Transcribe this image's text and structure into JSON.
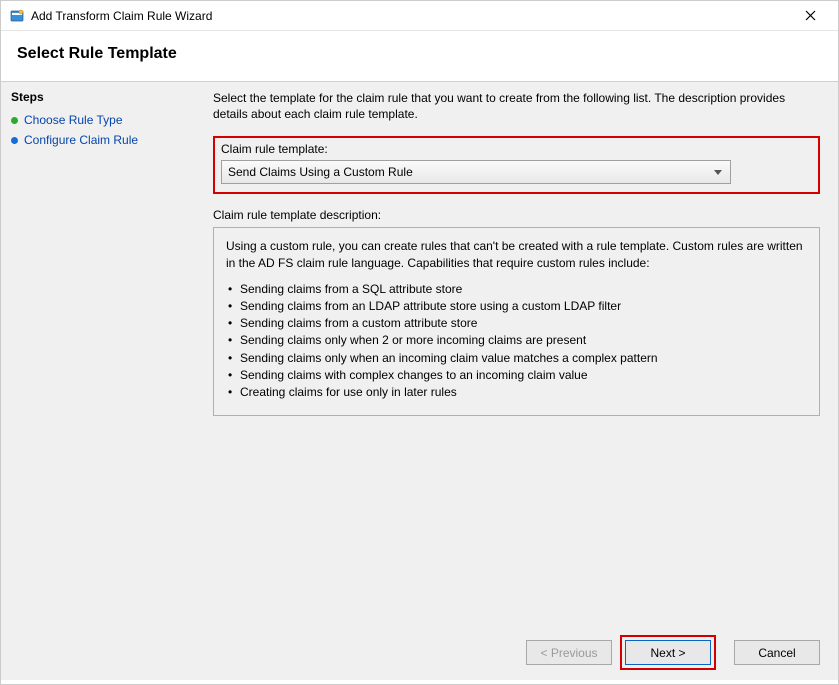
{
  "titlebar": {
    "title": "Add Transform Claim Rule Wizard",
    "close_label": "✕"
  },
  "header": {
    "title": "Select Rule Template"
  },
  "sidebar": {
    "heading": "Steps",
    "items": [
      {
        "label": "Choose Rule Type",
        "state": "done"
      },
      {
        "label": "Configure Claim Rule",
        "state": "current"
      }
    ]
  },
  "content": {
    "intro": "Select the template for the claim rule that you want to create from the following list. The description provides details about each claim rule template.",
    "template_label": "Claim rule template:",
    "template_value": "Send Claims Using a Custom Rule",
    "desc_label": "Claim rule template description:",
    "desc_intro": "Using a custom rule, you can create rules that can't be created with a rule template.  Custom rules are written in the AD FS claim rule language.  Capabilities that require custom rules include:",
    "desc_bullets": [
      "Sending claims from a SQL attribute store",
      "Sending claims from an LDAP attribute store using a custom LDAP filter",
      "Sending claims from a custom attribute store",
      "Sending claims only when 2 or more incoming claims are present",
      "Sending claims only when an incoming claim value matches a complex pattern",
      "Sending claims with complex changes to an incoming claim value",
      "Creating claims for use only in later rules"
    ]
  },
  "footer": {
    "previous": "< Previous",
    "next": "Next >",
    "cancel": "Cancel"
  }
}
